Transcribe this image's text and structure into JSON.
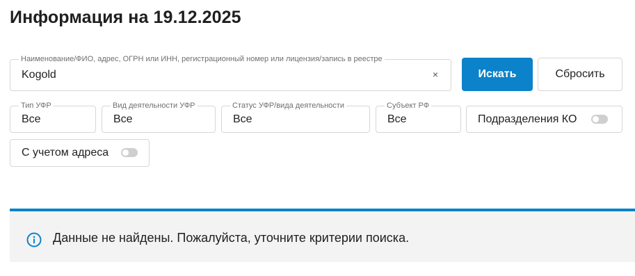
{
  "page": {
    "title": "Информация на 19.12.2025"
  },
  "search": {
    "legend": "Наименование/ФИО, адрес, ОГРН или ИНН, регистрационный номер или лицензия/запись в реестре",
    "value": "Kogold",
    "clear_glyph": "×"
  },
  "buttons": {
    "search_label": "Искать",
    "reset_label": "Сбросить"
  },
  "filters": [
    {
      "legend": "Тип УФР",
      "value": "Все"
    },
    {
      "legend": "Вид деятельности УФР",
      "value": "Все"
    },
    {
      "legend": "Статус УФР/вида деятельности",
      "value": "Все"
    },
    {
      "legend": "Субъект РФ",
      "value": "Все"
    }
  ],
  "toggles": {
    "subdivisions_label": "Подразделения КО",
    "subdivisions_on": false,
    "address_label": "С учетом адреса",
    "address_on": false
  },
  "info": {
    "icon": "info-icon",
    "message": "Данные не найдены. Пожалуйста, уточните критерии поиска."
  },
  "colors": {
    "accent": "#0b82c9",
    "panel_bg": "#f3f3f3",
    "border": "#d6d6d6"
  }
}
